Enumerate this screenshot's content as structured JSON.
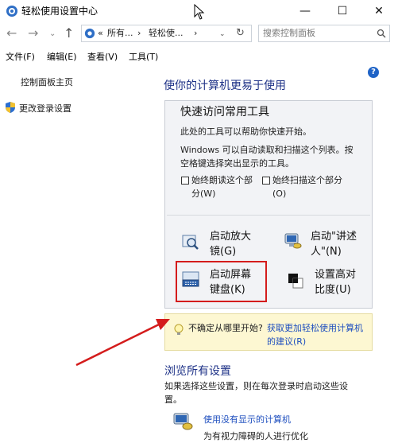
{
  "window": {
    "title": "轻松使用设置中心"
  },
  "address": {
    "prefix": "«",
    "crumb1": "所有...",
    "sep": "›",
    "crumb2": "轻松使...",
    "search_placeholder": "搜索控制面板"
  },
  "menu": [
    "文件(F)",
    "编辑(E)",
    "查看(V)",
    "工具(T)"
  ],
  "sidebar": {
    "home": "控制面板主页",
    "login": "更改登录设置"
  },
  "main": {
    "heading": "使你的计算机更易于使用",
    "panel_title": "快速访问常用工具",
    "desc1": "此处的工具可以帮助你快速开始。",
    "desc2_line1": "Windows 可以自动读取和扫描这个列表。按",
    "desc2_line2": "空格键选择突出显示的工具。",
    "checkbox1_line1": "始终朗读这个部",
    "checkbox1_line2": "分(W)",
    "checkbox2_line1": "始终扫描这个部分",
    "checkbox2_line2": "(O)",
    "tools": {
      "magnifier_line1": "启动放大",
      "magnifier_line2": "镜(G)",
      "narrator_line1": "启动\"讲述",
      "narrator_line2": "人\"(N)",
      "keyboard_line1": "启动屏幕",
      "keyboard_line2": "键盘(K)",
      "contrast_line1": "设置高对",
      "contrast_line2": "比度(U)"
    },
    "tip_text": "不确定从哪里开始?",
    "tip_link_line1": "获取更加轻松使用计算机",
    "tip_link_line2": "的建议(R)",
    "section2_title": "浏览所有设置",
    "section2_desc_line1": "如果选择这些设置，则在每次登录时启动这些设",
    "section2_desc_line2": "置。",
    "link1": "使用没有显示的计算机",
    "link1_sub": "为有视力障碍的人进行优化"
  },
  "icons": {
    "help": "?"
  },
  "colors": {
    "highlight": "#d41c1c",
    "heading": "#1e3287",
    "link": "#1f4fbf"
  }
}
